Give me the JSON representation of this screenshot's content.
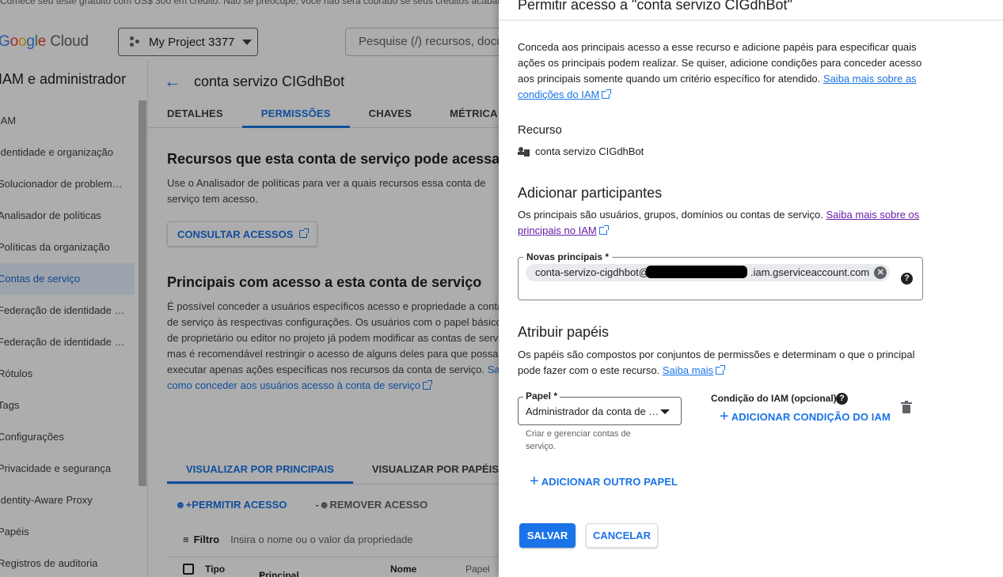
{
  "banner": "Comece seu teste gratuito com US$ 300 em crédito. Não se preocupe, você não será cobrado se seus créditos acabarem.",
  "header": {
    "logo_google": [
      "G",
      "o",
      "o",
      "g",
      "l",
      "e"
    ],
    "logo_cloud": "Cloud",
    "project": "My Project 3377",
    "search_placeholder": "Pesquise (/) recursos, documentos, produtos e mais"
  },
  "sidebar": {
    "title": "IAM e administrador",
    "items": [
      {
        "label": "IAM"
      },
      {
        "label": "Identidade e organização"
      },
      {
        "label": "Solucionador de problem…"
      },
      {
        "label": "Analisador de políticas"
      },
      {
        "label": "Políticas da organização"
      },
      {
        "label": "Contas de serviço",
        "active": true
      },
      {
        "label": "Federação de identidade …"
      },
      {
        "label": "Federação de identidade …"
      },
      {
        "label": "Rótulos"
      },
      {
        "label": "Tags"
      },
      {
        "label": "Configurações"
      },
      {
        "label": "Privacidade e segurança"
      },
      {
        "label": "Identity-Aware Proxy"
      },
      {
        "label": "Papéis"
      },
      {
        "label": "Registros de auditoria"
      }
    ]
  },
  "main": {
    "title": "conta servizo CIGdhBot",
    "tabs": [
      "DETALHES",
      "PERMISSÕES",
      "CHAVES",
      "MÉTRICA"
    ],
    "resources_heading": "Recursos que esta conta de serviço pode acessar",
    "resources_text": "Use o Analisador de políticas para ver a quais recursos essa conta de serviço tem acesso.",
    "consult_button": "CONSULTAR ACESSOS",
    "principals_heading": "Principais com acesso a esta conta de serviço",
    "principals_text": "É possível conceder a usuários específicos acesso e propriedade a contas de serviço às respectivas configurações. Os usuários com o papel básico de proprietário ou editor no projeto já podem modificar as contas de serviço, mas é recomendável restringir o acesso de alguns deles para que possam executar apenas ações específicas nos recursos da conta de serviço.",
    "principals_link": "Saiba como conceder aos usuários acesso à conta de serviço",
    "view_tabs": [
      "VISUALIZAR POR PRINCIPAIS",
      "VISUALIZAR POR PAPÉIS"
    ],
    "grant_label": "PERMITIR ACESSO",
    "revoke_label": "REMOVER ACESSO",
    "filter_label": "Filtro",
    "filter_placeholder": "Insira o nome ou o valor da propriedade",
    "columns": [
      "Tipo",
      "Principal",
      "Nome",
      "Papel"
    ]
  },
  "panel": {
    "title": "Permitir acesso a \"conta servizo CIGdhBot\"",
    "intro": "Conceda aos principais acesso a esse recurso e adicione papéis para especificar quais ações os principais podem realizar. Se quiser, adicione condições para conceder acesso aos principais somente quando um critério específico for atendido.",
    "intro_link": "Saiba mais sobre as condições do IAM",
    "resource_heading": "Recurso",
    "resource_name": "conta servizo CIGdhBot",
    "add_heading": "Adicionar participantes",
    "add_text": "Os principais são usuários, grupos, domínios ou contas de serviço.",
    "add_link": "Saiba mais sobre os principais no IAM",
    "new_principals_label": "Novas principais *",
    "chip_prefix": "conta-servizo-cigdhbot@",
    "chip_suffix": ".iam.gserviceaccount.com",
    "roles_heading": "Atribuir papéis",
    "roles_text": "Os papéis são compostos por conjuntos de permissões e determinam o que o principal pode fazer com o este recurso.",
    "roles_link": "Saiba mais",
    "role_label": "Papel *",
    "role_value": "Administrador da conta de …",
    "role_hint": "Criar e gerenciar contas de serviço.",
    "condition_label": "Condição do IAM (opcional)",
    "add_condition": "ADICIONAR CONDIÇÃO DO IAM",
    "add_role": "ADICIONAR OUTRO PAPEL",
    "save": "SALVAR",
    "cancel": "CANCELAR"
  }
}
